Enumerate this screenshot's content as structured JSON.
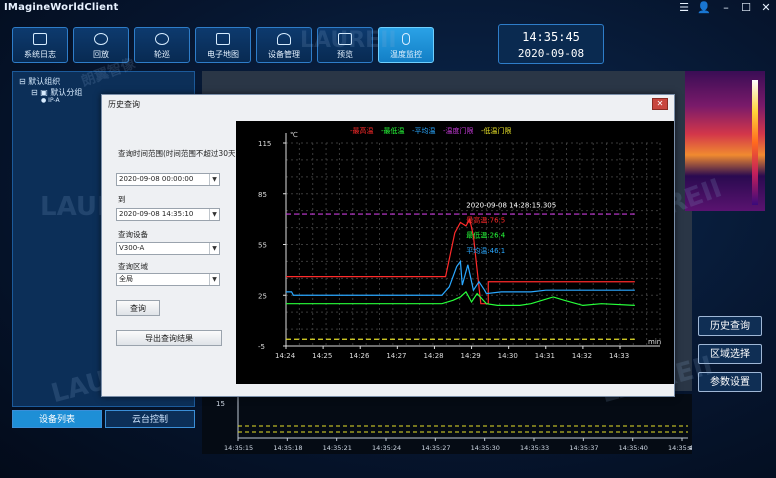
{
  "app": {
    "title": "IMagineWorldClient"
  },
  "toolbar": {
    "items": [
      {
        "label": "系统日志",
        "active": false
      },
      {
        "label": "回放",
        "active": false
      },
      {
        "label": "轮巡",
        "active": false
      },
      {
        "label": "电子地图",
        "active": false
      },
      {
        "label": "设备管理",
        "active": false
      },
      {
        "label": "预览",
        "active": false
      },
      {
        "label": "温度监控",
        "active": true
      }
    ]
  },
  "clock": {
    "time": "14:35:45",
    "date": "2020-09-08"
  },
  "left_panel": {
    "tree": [
      "默认组织",
      "默认分组",
      "IP-A"
    ],
    "tabs": [
      "设备列表",
      "云台控制"
    ]
  },
  "right_buttons": [
    "历史查询",
    "区域选择",
    "参数设置"
  ],
  "watermark": {
    "text": "LAUREII",
    "subtext": "朗翼智像"
  },
  "bottom_chart": {
    "y_label": "15",
    "x_ticks": [
      "14:35:15",
      "14:35:18",
      "14:35:21",
      "14:35:24",
      "14:35:27",
      "14:35:30",
      "14:35:33",
      "14:35:37",
      "14:35:40",
      "14:35:43"
    ],
    "x_unit": "s"
  },
  "dialog": {
    "title": "历史查询",
    "hint": "查询时间范围(时间范围不超过30天)",
    "start_time": "2020-09-08 00:00:00",
    "to_label": "到",
    "end_time": "2020-09-08 14:35:10",
    "device_label": "查询设备",
    "device_value": "V300-A",
    "area_label": "查询区域",
    "area_value": "全局",
    "query_button": "查询",
    "export_button": "导出查询结果"
  },
  "chart_data": {
    "type": "line",
    "legend": [
      "最高温",
      "最低温",
      "平均温",
      "温度门限",
      "低温门限"
    ],
    "y_unit": "℃",
    "x_unit": "min",
    "y_ticks": [
      "115",
      "85",
      "55",
      "25",
      "-5"
    ],
    "ylim": [
      -5,
      115
    ],
    "x_ticks": [
      "14:24",
      "14:25",
      "14:26",
      "14:27",
      "14:28",
      "14:29",
      "14:30",
      "14:31",
      "14:32",
      "14:33"
    ],
    "tooltip": {
      "time": "2020-09-08 14:28:15.305",
      "max_label": "最高温:76.5",
      "min_label": "最低温:26.4",
      "avg_label": "平均温:46.1"
    },
    "series": [
      {
        "name": "最高温",
        "color": "#ff2a2a",
        "x": [
          0,
          4.0,
          4.3,
          4.55,
          4.7,
          4.85,
          4.95,
          5.05,
          5.25,
          5.45,
          5.45,
          9.4
        ],
        "y": [
          36,
          36,
          36,
          62,
          68,
          66,
          70,
          60,
          20,
          20,
          33,
          33
        ]
      },
      {
        "name": "最低温",
        "color": "#27ff3a",
        "x": [
          0,
          4.2,
          4.5,
          4.7,
          4.85,
          5.0,
          5.15,
          5.4,
          5.7,
          6.0,
          6.3,
          6.6,
          6.9,
          7.2,
          7.5,
          8.0,
          8.5,
          9.4
        ],
        "y": [
          20,
          20,
          22,
          24,
          27,
          21,
          26,
          20,
          19,
          19,
          19,
          20,
          22,
          24,
          22,
          19,
          20,
          19
        ]
      },
      {
        "name": "平均温",
        "color": "#2aa8ff",
        "x": [
          0,
          0.15,
          0.2,
          4.2,
          4.4,
          4.6,
          4.7,
          4.75,
          4.9,
          5.05,
          5.2,
          5.35,
          5.4,
          5.8,
          6.2,
          6.6,
          7.0,
          7.4,
          7.8,
          8.5,
          9.4
        ],
        "y": [
          27,
          27,
          25,
          25,
          30,
          42,
          45,
          31,
          43,
          28,
          33,
          28,
          26,
          27,
          27,
          27,
          28,
          28,
          28,
          28,
          28
        ]
      },
      {
        "name": "温度门限",
        "color": "#c63ad9",
        "x": [
          0,
          9.4
        ],
        "y": [
          73,
          73
        ]
      },
      {
        "name": "低温门限",
        "color": "#e6e028",
        "x": [
          0,
          9.4
        ],
        "y": [
          -1,
          -1
        ]
      }
    ]
  }
}
